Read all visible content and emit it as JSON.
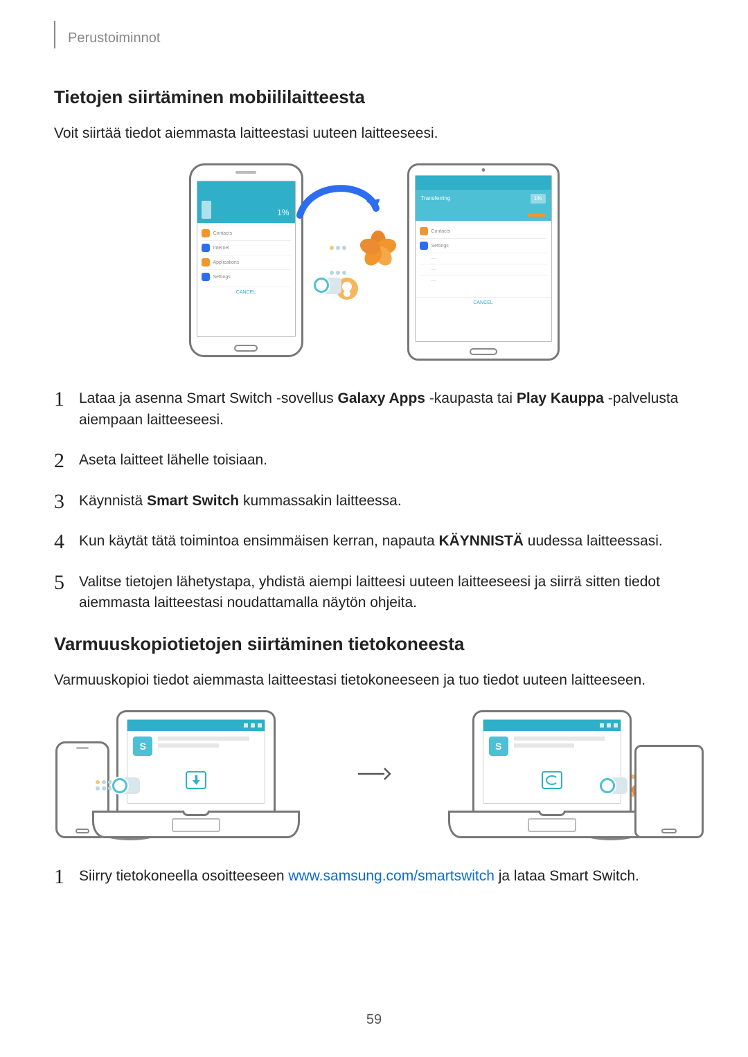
{
  "header": {
    "title": "Perustoiminnot"
  },
  "sections": {
    "s1": {
      "heading": "Tietojen siirtäminen mobiililaitteesta",
      "intro": "Voit siirtää tiedot aiemmasta laitteestasi uuteen laitteeseesi.",
      "steps": {
        "i1": {
          "pre": "Lataa ja asenna Smart Switch -sovellus ",
          "b1": "Galaxy Apps",
          "mid": " -kaupasta tai ",
          "b2": "Play Kauppa",
          "post": " -palvelusta aiempaan laitteeseesi."
        },
        "i2": "Aseta laitteet lähelle toisiaan.",
        "i3": {
          "pre": "Käynnistä ",
          "b1": "Smart Switch",
          "post": " kummassakin laitteessa."
        },
        "i4": {
          "pre": "Kun käytät tätä toimintoa ensimmäisen kerran, napauta ",
          "b1": "KÄYNNISTÄ",
          "post": " uudessa laitteessasi."
        },
        "i5": "Valitse tietojen lähetystapa, yhdistä aiempi laitteesi uuteen laitteeseesi ja siirrä sitten tiedot aiemmasta laitteestasi noudattamalla näytön ohjeita."
      }
    },
    "s2": {
      "heading": "Varmuuskopiotietojen siirtäminen tietokoneesta",
      "intro": "Varmuuskopioi tiedot aiemmasta laitteestasi tietokoneeseen ja tuo tiedot uuteen laitteeseen.",
      "steps": {
        "i1": {
          "pre": "Siirry tietokoneella osoitteeseen ",
          "link": "www.samsung.com/smartswitch",
          "post": " ja lataa Smart Switch."
        }
      }
    }
  },
  "page_number": "59",
  "ui_labels": {
    "phone_transfer_percent": "1%",
    "phone_item_contacts": "Contacts",
    "phone_item_internet": "Internet",
    "phone_item_apps": "Applications",
    "phone_item_settings": "Settings",
    "phone_cancel": "CANCEL",
    "tablet_transferring": "Transferring",
    "tablet_percent": "1%",
    "tablet_item_contacts": "Contacts",
    "tablet_item_settings": "Settings",
    "tablet_cancel": "CANCEL",
    "s_badge": "S"
  }
}
